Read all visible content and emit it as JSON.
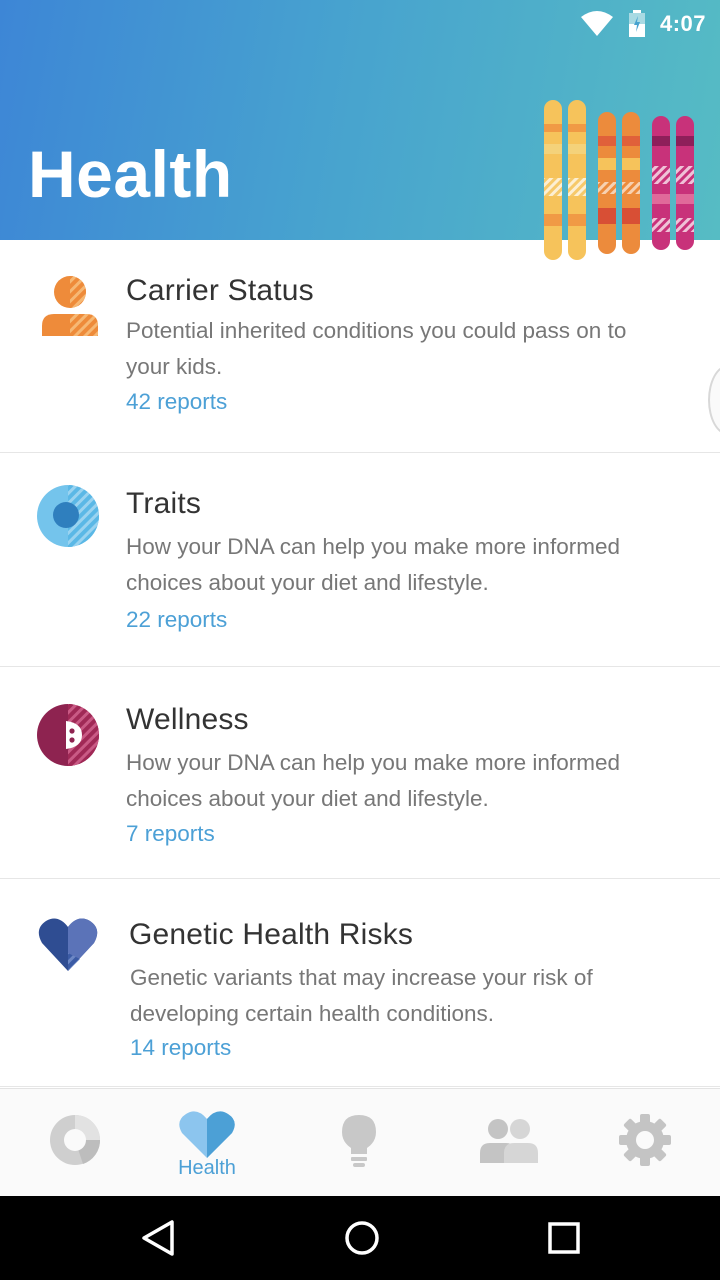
{
  "status_bar": {
    "time": "4:07",
    "icons": [
      "wifi-icon",
      "battery-icon"
    ]
  },
  "header": {
    "title": "Health",
    "illustration": "chromosomes-illustration",
    "gradient": [
      "#3d86d6",
      "#56bcc4"
    ]
  },
  "categories": [
    {
      "title": "Carrier Status",
      "description": "Potential inherited conditions you could pass on to your kids.",
      "count": "42 reports",
      "icon": "person-icon",
      "color": "#ee8b3a"
    },
    {
      "title": "Traits",
      "description": "How your DNA can help you make more informed choices about your diet and lifestyle.",
      "count": "22 reports",
      "icon": "eye-icon",
      "color": "#5bb8e6"
    },
    {
      "title": "Wellness",
      "description": "How your DNA can help you make more informed choices about your diet and lifestyle.",
      "count": "7 reports",
      "icon": "wellness-icon",
      "color": "#a02956"
    },
    {
      "title": "Genetic Health Risks",
      "description": "Genetic variants that may increase your risk of developing certain health conditions.",
      "count": "14 reports",
      "icon": "heart-icon",
      "color": "#2f4d92"
    }
  ],
  "bottom_nav": {
    "tabs": [
      {
        "icon": "ancestry-pie-icon",
        "label": ""
      },
      {
        "icon": "heart-icon",
        "label": "Health"
      },
      {
        "icon": "lightbulb-icon",
        "label": ""
      },
      {
        "icon": "relatives-icon",
        "label": ""
      },
      {
        "icon": "gear-icon",
        "label": ""
      }
    ],
    "active_index": 1,
    "active_color": "#4ca0d6",
    "inactive_color": "#c4c4c4"
  },
  "system_nav": {
    "buttons": [
      "back-icon",
      "home-icon",
      "recents-icon"
    ]
  }
}
